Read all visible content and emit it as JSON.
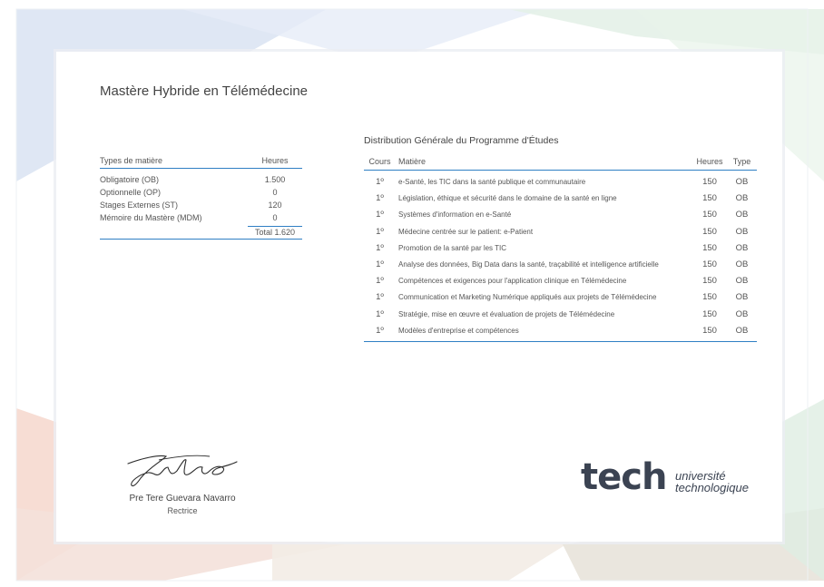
{
  "document": {
    "title": "Mastère Hybride en Télémédecine"
  },
  "subject_types": {
    "headers": [
      "Types de matière",
      "Heures"
    ],
    "rows": [
      {
        "label": "Obligatoire (OB)",
        "hours": "1.500"
      },
      {
        "label": "Optionnelle (OP)",
        "hours": "0"
      },
      {
        "label": "Stages Externes (ST)",
        "hours": "120"
      },
      {
        "label": "Mémoire du Mastère (MDM)",
        "hours": "0"
      }
    ],
    "total": "Total 1.620"
  },
  "distribution": {
    "title": "Distribution Générale du Programme d'Études",
    "headers": [
      "Cours",
      "Matière",
      "Heures",
      "Type"
    ],
    "rows": [
      {
        "course": "1º",
        "subject": "e-Santé, les TIC dans la santé publique et communautaire",
        "hours": "150",
        "type": "OB"
      },
      {
        "course": "1º",
        "subject": "Législation, éthique et sécurité dans le domaine de la santé en ligne",
        "hours": "150",
        "type": "OB"
      },
      {
        "course": "1º",
        "subject": "Systèmes d'information en e-Santé",
        "hours": "150",
        "type": "OB"
      },
      {
        "course": "1º",
        "subject": "Médecine centrée sur le patient: e-Patient",
        "hours": "150",
        "type": "OB"
      },
      {
        "course": "1º",
        "subject": "Promotion de la santé par les TIC",
        "hours": "150",
        "type": "OB"
      },
      {
        "course": "1º",
        "subject": "Analyse des données, Big Data dans la santé, traçabilité et intelligence artificielle",
        "hours": "150",
        "type": "OB"
      },
      {
        "course": "1º",
        "subject": "Compétences et exigences pour l'application clinique en Télémédecine",
        "hours": "150",
        "type": "OB"
      },
      {
        "course": "1º",
        "subject": "Communication et Marketing Numérique appliqués aux projets de Télémédecine",
        "hours": "150",
        "type": "OB"
      },
      {
        "course": "1º",
        "subject": "Stratégie, mise en œuvre et évaluation de projets de Télémédecine",
        "hours": "150",
        "type": "OB"
      },
      {
        "course": "1º",
        "subject": "Modèles d'entreprise et compétences",
        "hours": "150",
        "type": "OB"
      }
    ]
  },
  "signature": {
    "name": "Pre Tere Guevara Navarro",
    "role": "Rectrice"
  },
  "logo": {
    "wordmark": "tech",
    "line1": "université",
    "line2": "technologique",
    "accent_color": "#3b4352"
  },
  "colors": {
    "rule": "#2f7fc4"
  }
}
